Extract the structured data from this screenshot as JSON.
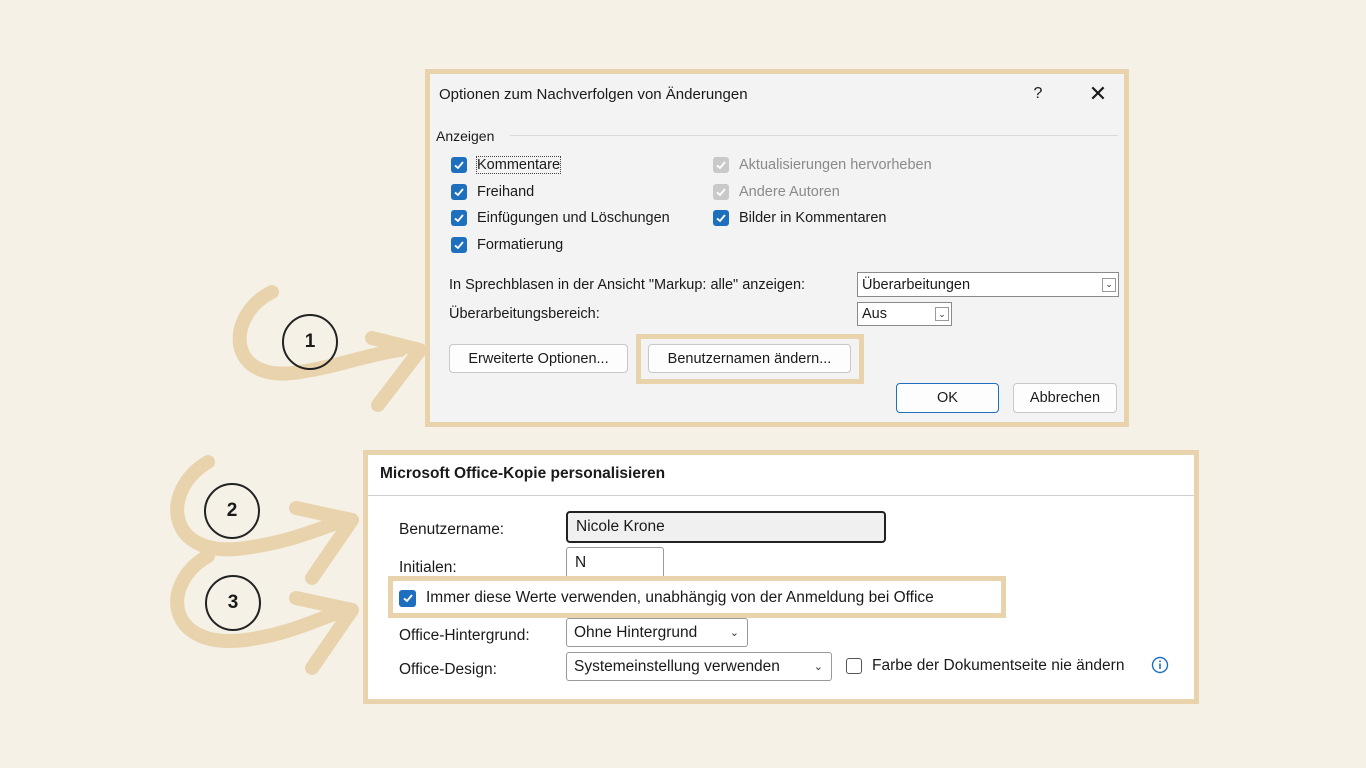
{
  "dialog1": {
    "title": "Optionen zum Nachverfolgen von Änderungen",
    "help_label": "?",
    "close_label": "✕",
    "group_label": "Anzeigen",
    "checkboxes_left": [
      {
        "label": "Kommentare",
        "checked": true
      },
      {
        "label": "Freihand",
        "checked": true
      },
      {
        "label": "Einfügungen und Löschungen",
        "checked": true
      },
      {
        "label": "Formatierung",
        "checked": true
      }
    ],
    "checkboxes_right": [
      {
        "label": "Aktualisierungen hervorheben",
        "checked": true,
        "disabled": true
      },
      {
        "label": "Andere Autoren",
        "checked": true,
        "disabled": true
      },
      {
        "label": "Bilder in Kommentaren",
        "checked": true,
        "disabled": false
      }
    ],
    "balloons_label": "In Sprechblasen in der Ansicht \"Markup: alle\" anzeigen:",
    "balloons_value": "Überarbeitungen",
    "pane_label": "Überarbeitungsbereich:",
    "pane_value": "Aus",
    "advanced_button": "Erweiterte Optionen...",
    "change_user_button": "Benutzernamen ändern...",
    "ok_button": "OK",
    "cancel_button": "Abbrechen"
  },
  "dialog2": {
    "title": "Microsoft Office-Kopie personalisieren",
    "username_label": "Benutzername:",
    "username_value": "Nicole Krone",
    "initials_label": "Initialen:",
    "initials_value": "N",
    "always_use_label": "Immer diese Werte verwenden, unabhängig von der Anmeldung bei Office",
    "always_use_checked": true,
    "background_label": "Office-Hintergrund:",
    "background_value": "Ohne Hintergrund",
    "design_label": "Office-Design:",
    "design_value": "Systemeinstellung verwenden",
    "page_color_label": "Farbe der Dokumentseite nie ändern",
    "page_color_checked": false
  },
  "steps": [
    "1",
    "2",
    "3"
  ],
  "colors": {
    "background": "#f5f1e6",
    "highlight": "#e8d3ad",
    "accent": "#1f6fbf"
  }
}
